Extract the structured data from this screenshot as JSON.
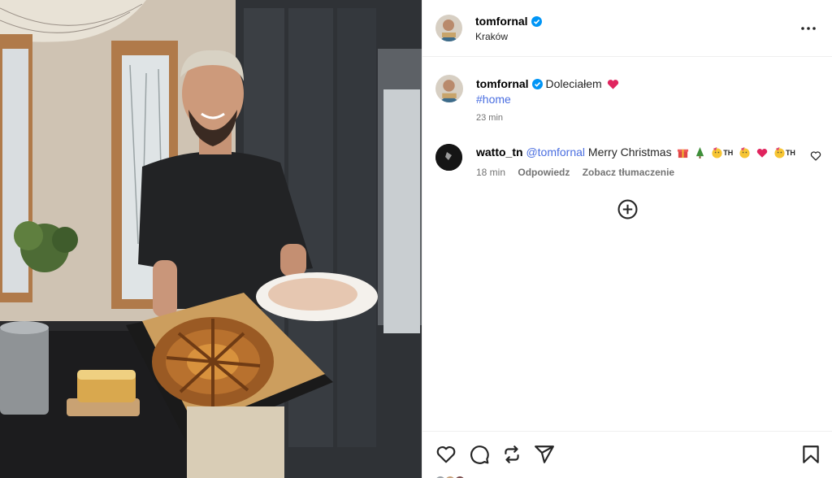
{
  "post": {
    "author": "tomfornal",
    "location": "Kraków",
    "verified": true
  },
  "caption": {
    "author": "tomfornal",
    "text": "Doleciałem",
    "heart_emoji": "red-heart",
    "hashtag": "#home",
    "time": "23 min"
  },
  "comments": [
    {
      "author": "watto_tn",
      "mention": "@tomfornal",
      "text": "Merry Christmas",
      "emojis": [
        "gift",
        "christmas-tree",
        "party-face",
        "TH",
        "party-face",
        "heart",
        "party-face",
        "TH"
      ],
      "th_label": "TH",
      "time": "18 min",
      "reply_label": "Odpowiedz",
      "translate_label": "Zobacz tłumaczenie"
    }
  ],
  "icons": {
    "more": "more-horizontal-icon",
    "load_more": "plus-circle-icon",
    "like": "heart-outline-icon",
    "comment": "comment-icon",
    "share_repost": "repost-icon",
    "send": "send-icon",
    "save": "bookmark-icon"
  },
  "colors": {
    "link": "#4a6ee0",
    "verified": "#0095f6",
    "muted": "#737373",
    "heart": "#e0245e"
  }
}
